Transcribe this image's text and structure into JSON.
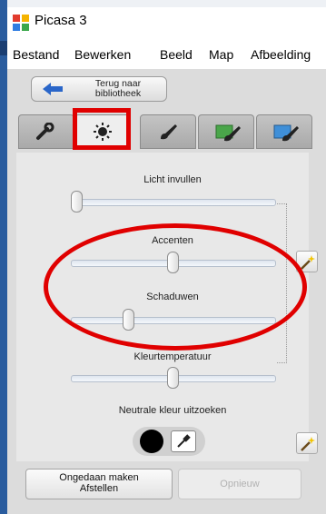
{
  "window": {
    "title": "Picasa 3",
    "app_icon": "picasa-icon"
  },
  "menu": [
    "Bestand",
    "Bewerken",
    "Beeld",
    "Map",
    "Afbeelding"
  ],
  "back_button": {
    "label_line1": "Terug naar",
    "label_line2": "bibliotheek",
    "icon": "arrow-left-icon"
  },
  "tabs": [
    {
      "icon": "wrench-icon",
      "selected": false
    },
    {
      "icon": "sun-icon",
      "selected": true
    },
    {
      "icon": "brush-icon",
      "selected": false
    },
    {
      "icon": "green-brush-icon",
      "selected": false
    },
    {
      "icon": "blue-brush-icon",
      "selected": false
    }
  ],
  "sliders": [
    {
      "label": "Licht invullen",
      "value": 0.0
    },
    {
      "label": "Accenten",
      "value": 0.5
    },
    {
      "label": "Schaduwen",
      "value": 0.27
    },
    {
      "label": "Kleurtemperatuur",
      "value": 0.5
    }
  ],
  "neutral_color": {
    "label": "Neutrale kleur uitzoeken",
    "swatch_color": "#000000"
  },
  "undo_button": {
    "label_line1": "Ongedaan maken",
    "label_line2": "Afstellen"
  },
  "redo_button": {
    "label": "Opnieuw"
  },
  "annotation_color": "#e00000"
}
